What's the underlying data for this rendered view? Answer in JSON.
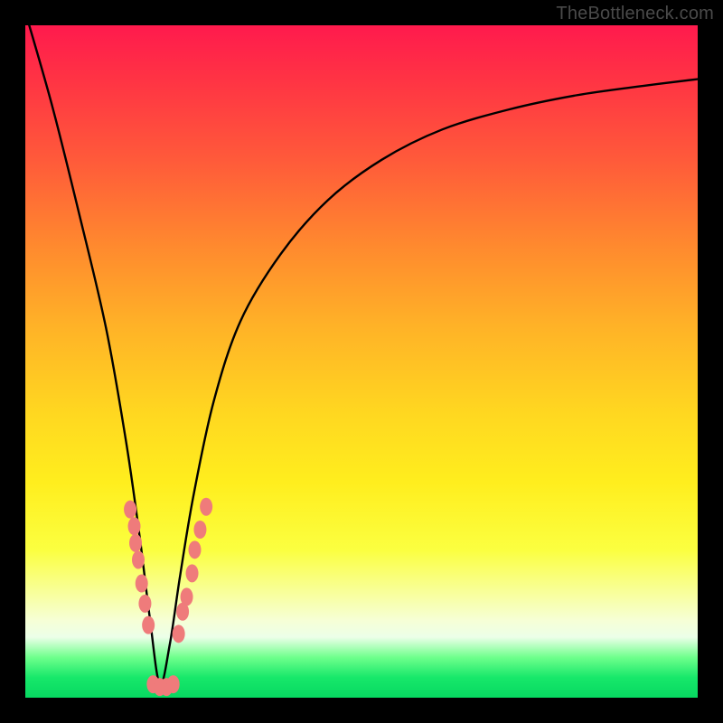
{
  "watermark": "TheBottleneck.com",
  "chart_data": {
    "type": "line",
    "title": "",
    "xlabel": "",
    "ylabel": "",
    "xlim": [
      0,
      100
    ],
    "ylim": [
      0,
      100
    ],
    "background_gradient": {
      "top_color": "#ff1a4d",
      "mid_color": "#ffee1e",
      "bottom_color": "#07d861"
    },
    "series": [
      {
        "name": "bottleneck-curve",
        "x": [
          0,
          4,
          8,
          12,
          15,
          17,
          18.5,
          20,
          21.5,
          23,
          25,
          28,
          32,
          38,
          45,
          53,
          62,
          72,
          82,
          92,
          100
        ],
        "y": [
          102,
          88,
          72,
          55,
          38,
          24,
          12,
          2,
          8,
          18,
          30,
          44,
          56,
          66,
          74,
          80,
          84.5,
          87.5,
          89.6,
          91,
          92
        ]
      }
    ],
    "marker_clusters": [
      {
        "name": "left-arm-markers",
        "points": [
          {
            "x": 15.6,
            "y": 28.0
          },
          {
            "x": 16.2,
            "y": 25.5
          },
          {
            "x": 16.4,
            "y": 23.0
          },
          {
            "x": 16.8,
            "y": 20.5
          },
          {
            "x": 17.3,
            "y": 17.0
          },
          {
            "x": 17.8,
            "y": 14.0
          },
          {
            "x": 18.3,
            "y": 10.8
          }
        ]
      },
      {
        "name": "valley-markers",
        "points": [
          {
            "x": 19.0,
            "y": 2.0
          },
          {
            "x": 20.0,
            "y": 1.6
          },
          {
            "x": 21.0,
            "y": 1.6
          },
          {
            "x": 22.0,
            "y": 2.0
          }
        ]
      },
      {
        "name": "right-arm-markers",
        "points": [
          {
            "x": 22.8,
            "y": 9.5
          },
          {
            "x": 23.4,
            "y": 12.8
          },
          {
            "x": 24.0,
            "y": 15.0
          },
          {
            "x": 24.8,
            "y": 18.5
          },
          {
            "x": 25.2,
            "y": 22.0
          },
          {
            "x": 26.0,
            "y": 25.0
          },
          {
            "x": 26.9,
            "y": 28.4
          }
        ]
      }
    ],
    "marker_style": {
      "fill": "#ef7b7b",
      "rx": 7,
      "ry": 10
    }
  }
}
